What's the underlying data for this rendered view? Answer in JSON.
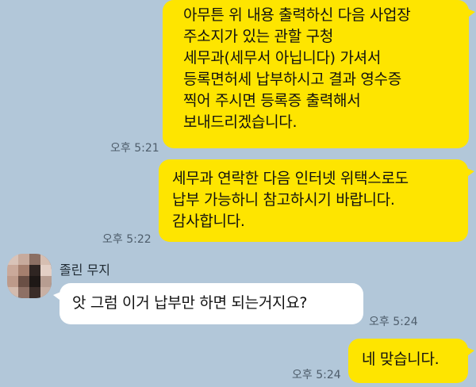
{
  "messages": [
    {
      "id": 1,
      "from": "me",
      "text": "아무튼 위 내용 출력하신 다음 사업장\n주소지가 있는 관할 구청\n세무과(세무서 아닙니다) 가셔서\n등록면허세 납부하시고 결과 영수증\n찍어 주시면 등록증 출력해서\n보내드리겠습니다.",
      "time": "오후 5:21"
    },
    {
      "id": 2,
      "from": "me",
      "text": "세무과 연락한 다음 인터넷 위택스로도\n납부 가능하니 참고하시기 바랍니다.\n감사합니다.",
      "time": "오후 5:22"
    },
    {
      "id": 3,
      "from": "other",
      "sender": "졸린 무지",
      "text": "앗 그럼 이거 납부만 하면 되는거지요?",
      "time": "오후 5:24"
    },
    {
      "id": 4,
      "from": "me",
      "text": "네 맞습니다.",
      "time": "오후 5:24"
    }
  ],
  "colors": {
    "background": "#b2c7d9",
    "my_bubble": "#fee500",
    "their_bubble": "#ffffff",
    "time_text": "#4e5d6b"
  },
  "icons": {
    "avatar": "profile-photo-pixelated"
  }
}
